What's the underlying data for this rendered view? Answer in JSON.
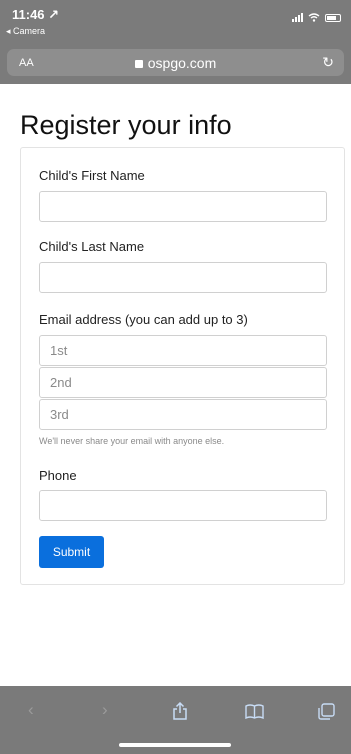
{
  "status_bar": {
    "time": "11:46 ↗",
    "back_label": "◂ Camera"
  },
  "browser": {
    "aa_label": "AA",
    "domain": "ospgo.com"
  },
  "page": {
    "title": "Register your info"
  },
  "form": {
    "first_name": {
      "label": "Child's First Name",
      "value": ""
    },
    "last_name": {
      "label": "Child's Last Name",
      "value": ""
    },
    "email": {
      "label": "Email address (you can add up to 3)",
      "placeholders": [
        "1st",
        "2nd",
        "3rd"
      ],
      "help": "We'll never share your email with anyone else."
    },
    "phone": {
      "label": "Phone",
      "value": ""
    },
    "submit_label": "Submit"
  },
  "colors": {
    "primary": "#0a6fdd",
    "chrome": "#7b7b7b"
  },
  "toolbar": {
    "icons": [
      "back-icon",
      "forward-icon",
      "share-icon",
      "bookmarks-icon",
      "tabs-icon"
    ]
  }
}
